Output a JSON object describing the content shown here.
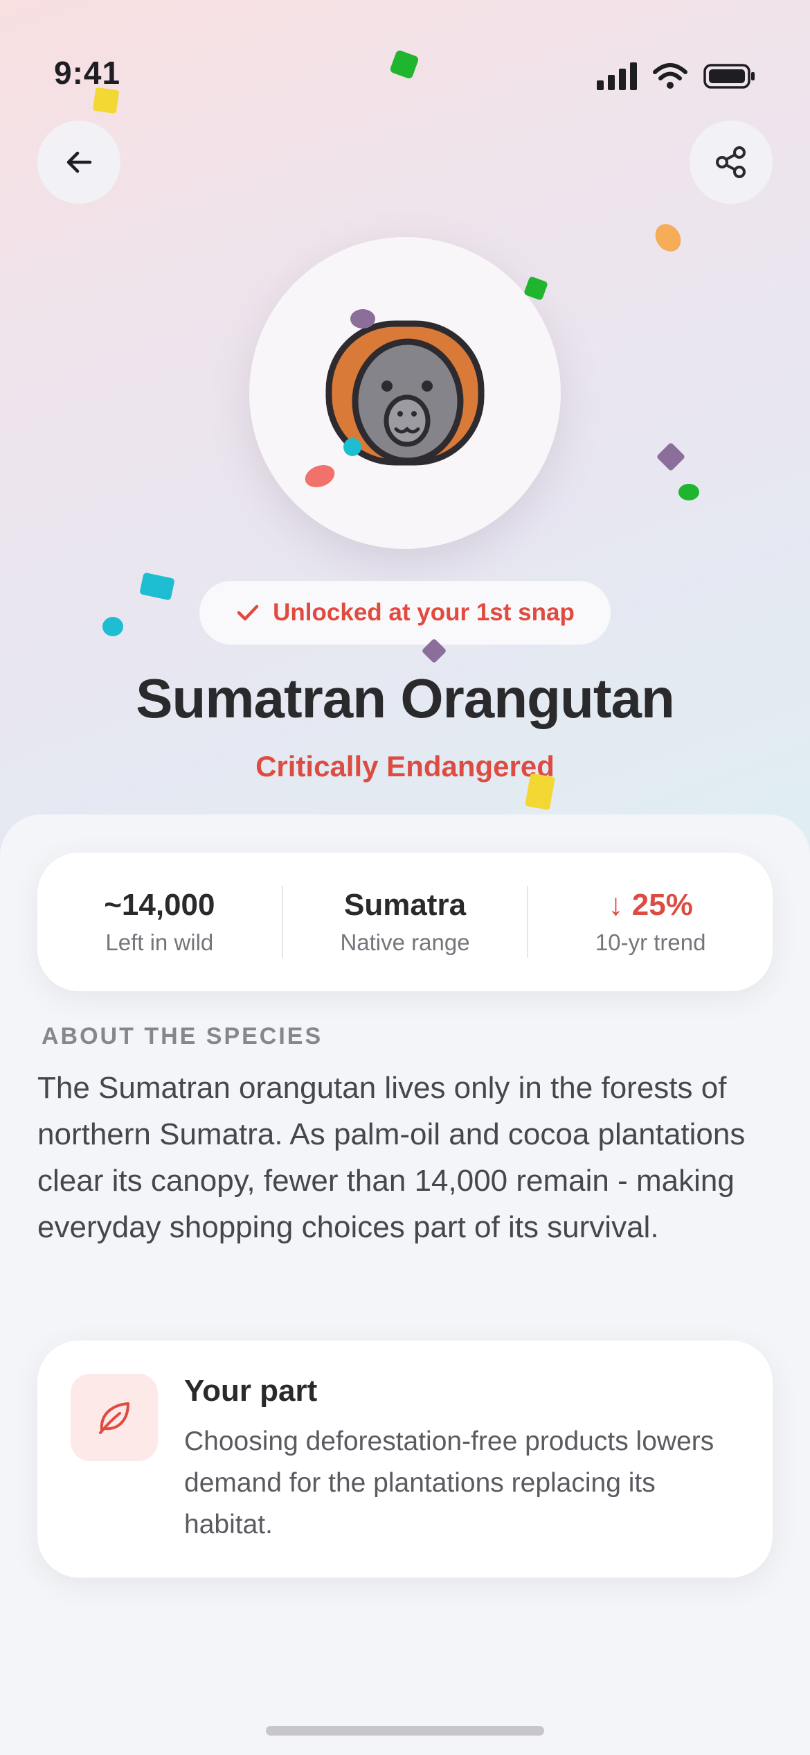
{
  "status_bar": {
    "time": "9:41"
  },
  "header": {
    "back_icon": "arrow-left-icon",
    "share_icon": "share-icon"
  },
  "hero": {
    "avatar_icon": "orangutan-icon",
    "unlock_badge": {
      "icon": "check-icon",
      "label": "Unlocked at your 1st snap"
    },
    "species_name": "Sumatran Orangutan",
    "conservation_status": "Critically Endangered"
  },
  "stats": [
    {
      "value": "~14,000",
      "label": "Left in wild",
      "color": "#2a2a2d"
    },
    {
      "value": "Sumatra",
      "label": "Native range",
      "color": "#2a2a2d"
    },
    {
      "value": "↓ 25%",
      "label": "10-yr trend",
      "color": "#dd4c43"
    }
  ],
  "about": {
    "title": "ABOUT THE SPECIES",
    "text": "The Sumatran orangutan lives only in the forests of northern Sumatra. As palm-oil and cocoa plantations clear its canopy, fewer than 14,000 remain - making everyday shopping choices part of its survival."
  },
  "your_part": {
    "icon": "leaf-icon",
    "title": "Your part",
    "text": "Choosing deforestation-free products lowers demand for the plantations replacing its habitat."
  },
  "colors": {
    "accent_red": "#dd4c43",
    "orangutan_fur": "#d97a38",
    "face_gray": "#85848b"
  }
}
